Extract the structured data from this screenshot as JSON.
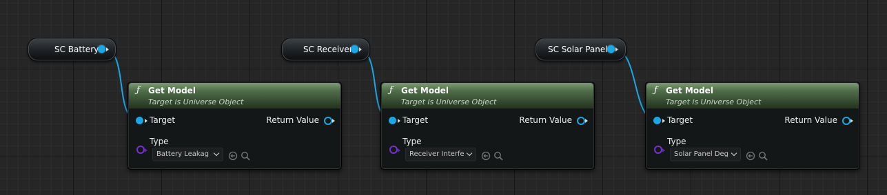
{
  "variables": [
    {
      "label": "SC Battery"
    },
    {
      "label": "SC Receiver"
    },
    {
      "label": "SC Solar Panel"
    }
  ],
  "functions": [
    {
      "icon": "ƒ",
      "title": "Get Model",
      "subtitle": "Target is Universe Object",
      "target_label": "Target",
      "return_label": "Return Value",
      "type_label": "Type",
      "type_value": "Battery Leakag"
    },
    {
      "icon": "ƒ",
      "title": "Get Model",
      "subtitle": "Target is Universe Object",
      "target_label": "Target",
      "return_label": "Return Value",
      "type_label": "Type",
      "type_value": "Receiver Interfe"
    },
    {
      "icon": "ƒ",
      "title": "Get Model",
      "subtitle": "Target is Universe Object",
      "target_label": "Target",
      "return_label": "Return Value",
      "type_label": "Type",
      "type_value": "Solar Panel Deg"
    }
  ],
  "colors": {
    "object_pin": "#19a7e6",
    "class_pin": "#7a2fd0",
    "function_header": "#506e4a",
    "grid_background": "#262626"
  }
}
